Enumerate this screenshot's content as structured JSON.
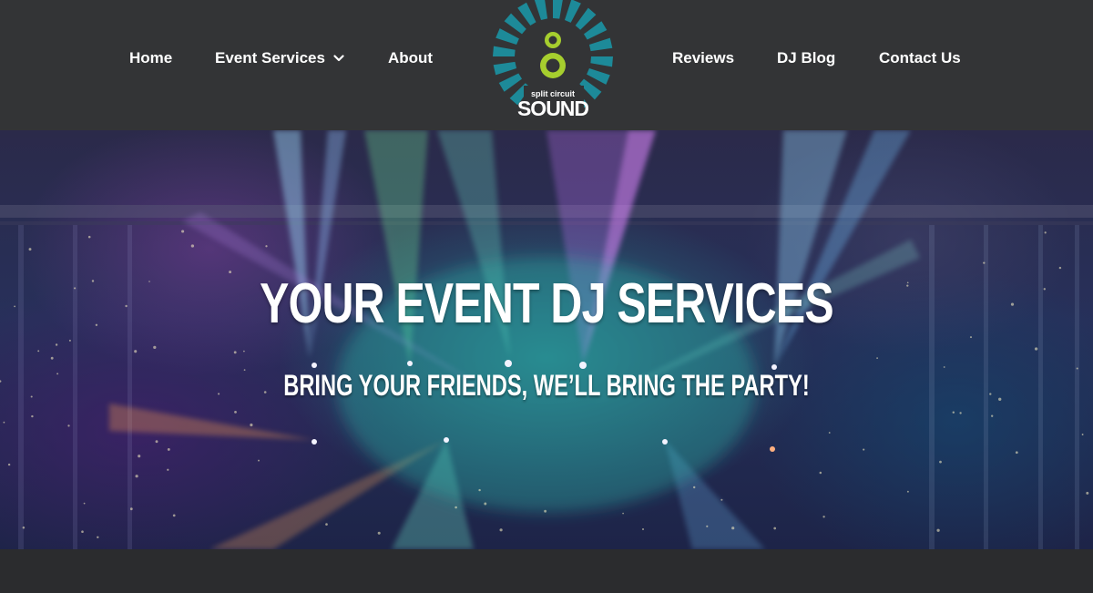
{
  "header": {
    "nav_left": [
      {
        "label": "Home"
      },
      {
        "label": "Event Services",
        "has_dropdown": true
      },
      {
        "label": "About"
      }
    ],
    "nav_right": [
      {
        "label": "Reviews"
      },
      {
        "label": "DJ Blog"
      },
      {
        "label": "Contact Us"
      }
    ],
    "logo": {
      "line1": "split circuit",
      "line2": "SOUND",
      "colors": {
        "rays": "#1d8a99",
        "dots": "#a6ce2e",
        "text": "#ffffff"
      }
    }
  },
  "hero": {
    "title": "YOUR EVENT DJ SERVICES",
    "subtitle": "BRING YOUR FRIENDS, WE’LL BRING THE PARTY!"
  },
  "colors": {
    "header_bg": "#333436",
    "page_bg": "#2b2c2e",
    "nav_text": "#ffffff"
  },
  "icons": {
    "dropdown": "chevron-down-icon"
  }
}
